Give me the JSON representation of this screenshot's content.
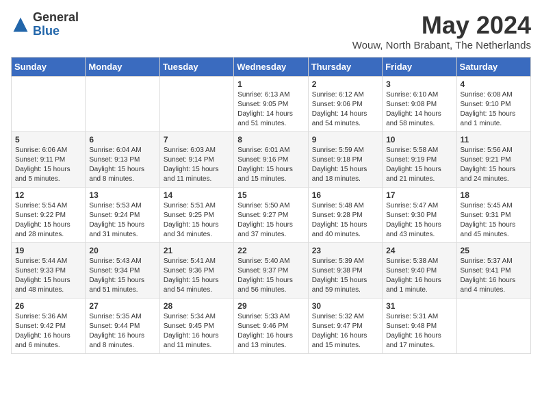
{
  "logo": {
    "general": "General",
    "blue": "Blue"
  },
  "title": "May 2024",
  "subtitle": "Wouw, North Brabant, The Netherlands",
  "days_of_week": [
    "Sunday",
    "Monday",
    "Tuesday",
    "Wednesday",
    "Thursday",
    "Friday",
    "Saturday"
  ],
  "weeks": [
    [
      {
        "day": "",
        "info": ""
      },
      {
        "day": "",
        "info": ""
      },
      {
        "day": "",
        "info": ""
      },
      {
        "day": "1",
        "info": "Sunrise: 6:13 AM\nSunset: 9:05 PM\nDaylight: 14 hours\nand 51 minutes."
      },
      {
        "day": "2",
        "info": "Sunrise: 6:12 AM\nSunset: 9:06 PM\nDaylight: 14 hours\nand 54 minutes."
      },
      {
        "day": "3",
        "info": "Sunrise: 6:10 AM\nSunset: 9:08 PM\nDaylight: 14 hours\nand 58 minutes."
      },
      {
        "day": "4",
        "info": "Sunrise: 6:08 AM\nSunset: 9:10 PM\nDaylight: 15 hours\nand 1 minute."
      }
    ],
    [
      {
        "day": "5",
        "info": "Sunrise: 6:06 AM\nSunset: 9:11 PM\nDaylight: 15 hours\nand 5 minutes."
      },
      {
        "day": "6",
        "info": "Sunrise: 6:04 AM\nSunset: 9:13 PM\nDaylight: 15 hours\nand 8 minutes."
      },
      {
        "day": "7",
        "info": "Sunrise: 6:03 AM\nSunset: 9:14 PM\nDaylight: 15 hours\nand 11 minutes."
      },
      {
        "day": "8",
        "info": "Sunrise: 6:01 AM\nSunset: 9:16 PM\nDaylight: 15 hours\nand 15 minutes."
      },
      {
        "day": "9",
        "info": "Sunrise: 5:59 AM\nSunset: 9:18 PM\nDaylight: 15 hours\nand 18 minutes."
      },
      {
        "day": "10",
        "info": "Sunrise: 5:58 AM\nSunset: 9:19 PM\nDaylight: 15 hours\nand 21 minutes."
      },
      {
        "day": "11",
        "info": "Sunrise: 5:56 AM\nSunset: 9:21 PM\nDaylight: 15 hours\nand 24 minutes."
      }
    ],
    [
      {
        "day": "12",
        "info": "Sunrise: 5:54 AM\nSunset: 9:22 PM\nDaylight: 15 hours\nand 28 minutes."
      },
      {
        "day": "13",
        "info": "Sunrise: 5:53 AM\nSunset: 9:24 PM\nDaylight: 15 hours\nand 31 minutes."
      },
      {
        "day": "14",
        "info": "Sunrise: 5:51 AM\nSunset: 9:25 PM\nDaylight: 15 hours\nand 34 minutes."
      },
      {
        "day": "15",
        "info": "Sunrise: 5:50 AM\nSunset: 9:27 PM\nDaylight: 15 hours\nand 37 minutes."
      },
      {
        "day": "16",
        "info": "Sunrise: 5:48 AM\nSunset: 9:28 PM\nDaylight: 15 hours\nand 40 minutes."
      },
      {
        "day": "17",
        "info": "Sunrise: 5:47 AM\nSunset: 9:30 PM\nDaylight: 15 hours\nand 43 minutes."
      },
      {
        "day": "18",
        "info": "Sunrise: 5:45 AM\nSunset: 9:31 PM\nDaylight: 15 hours\nand 45 minutes."
      }
    ],
    [
      {
        "day": "19",
        "info": "Sunrise: 5:44 AM\nSunset: 9:33 PM\nDaylight: 15 hours\nand 48 minutes."
      },
      {
        "day": "20",
        "info": "Sunrise: 5:43 AM\nSunset: 9:34 PM\nDaylight: 15 hours\nand 51 minutes."
      },
      {
        "day": "21",
        "info": "Sunrise: 5:41 AM\nSunset: 9:36 PM\nDaylight: 15 hours\nand 54 minutes."
      },
      {
        "day": "22",
        "info": "Sunrise: 5:40 AM\nSunset: 9:37 PM\nDaylight: 15 hours\nand 56 minutes."
      },
      {
        "day": "23",
        "info": "Sunrise: 5:39 AM\nSunset: 9:38 PM\nDaylight: 15 hours\nand 59 minutes."
      },
      {
        "day": "24",
        "info": "Sunrise: 5:38 AM\nSunset: 9:40 PM\nDaylight: 16 hours\nand 1 minute."
      },
      {
        "day": "25",
        "info": "Sunrise: 5:37 AM\nSunset: 9:41 PM\nDaylight: 16 hours\nand 4 minutes."
      }
    ],
    [
      {
        "day": "26",
        "info": "Sunrise: 5:36 AM\nSunset: 9:42 PM\nDaylight: 16 hours\nand 6 minutes."
      },
      {
        "day": "27",
        "info": "Sunrise: 5:35 AM\nSunset: 9:44 PM\nDaylight: 16 hours\nand 8 minutes."
      },
      {
        "day": "28",
        "info": "Sunrise: 5:34 AM\nSunset: 9:45 PM\nDaylight: 16 hours\nand 11 minutes."
      },
      {
        "day": "29",
        "info": "Sunrise: 5:33 AM\nSunset: 9:46 PM\nDaylight: 16 hours\nand 13 minutes."
      },
      {
        "day": "30",
        "info": "Sunrise: 5:32 AM\nSunset: 9:47 PM\nDaylight: 16 hours\nand 15 minutes."
      },
      {
        "day": "31",
        "info": "Sunrise: 5:31 AM\nSunset: 9:48 PM\nDaylight: 16 hours\nand 17 minutes."
      },
      {
        "day": "",
        "info": ""
      }
    ]
  ]
}
